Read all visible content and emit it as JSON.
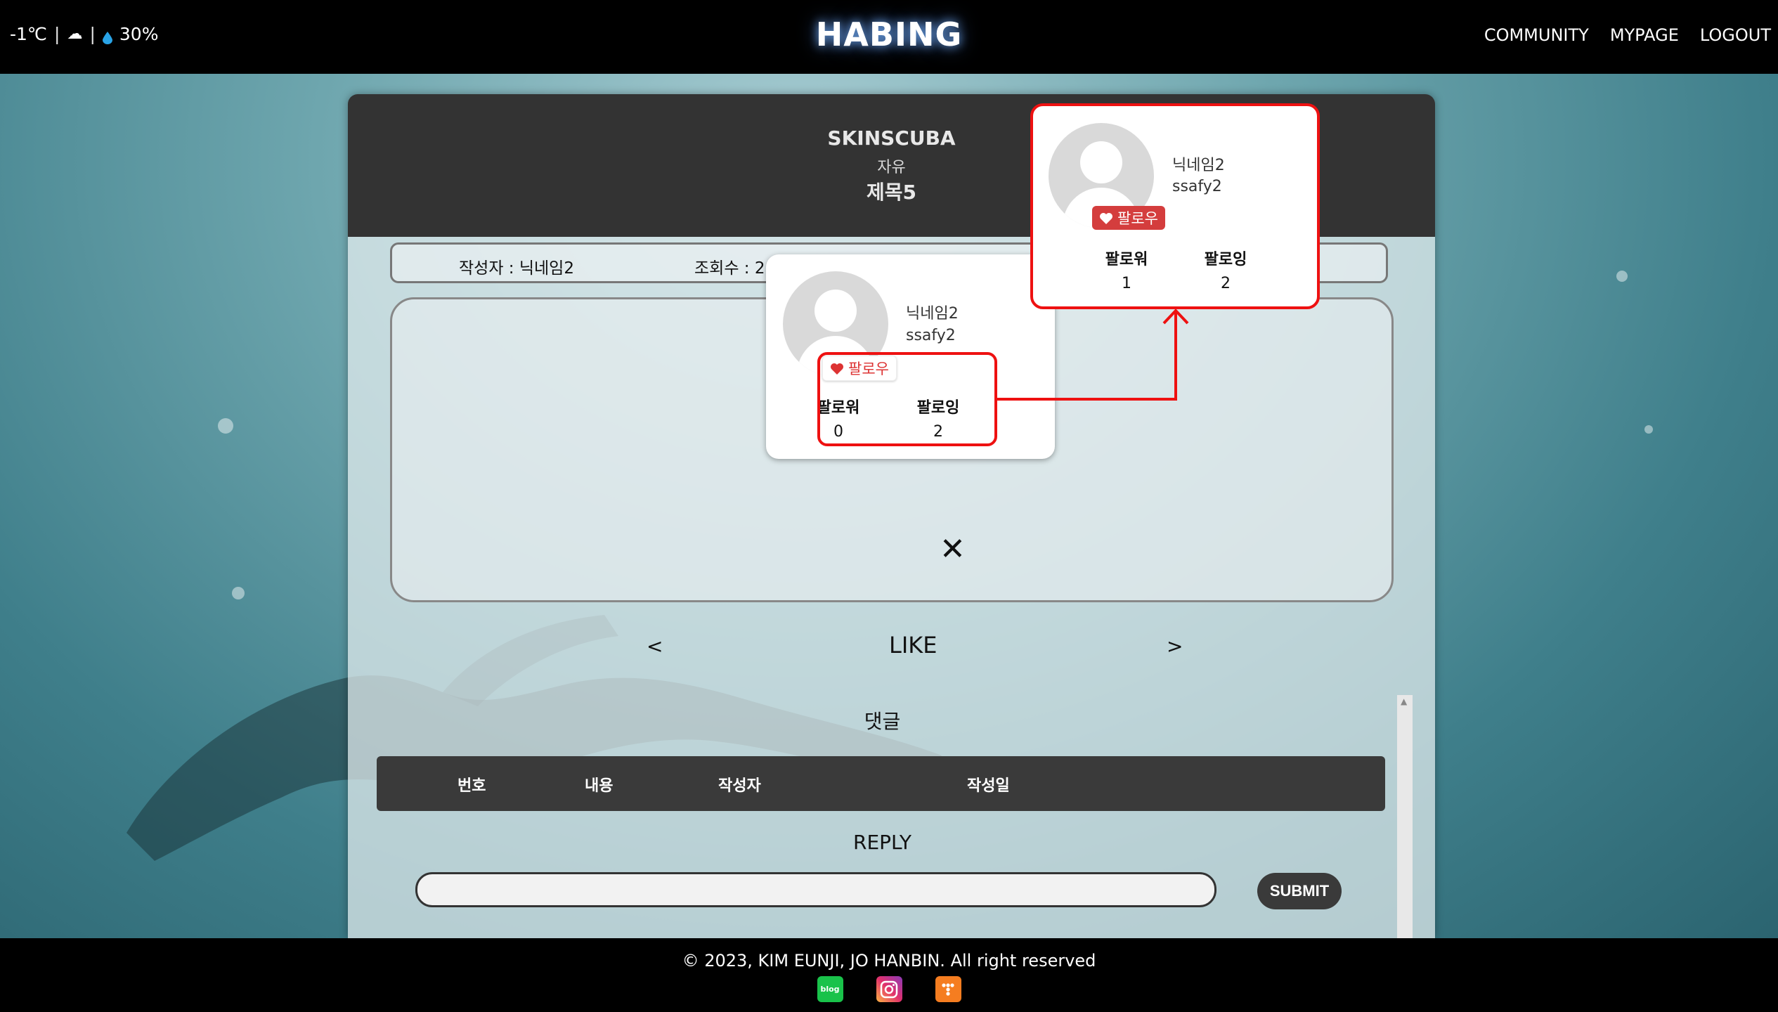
{
  "header": {
    "weather": {
      "temp": "-1℃",
      "sep1": "|",
      "cloud_icon": "☁",
      "sep2": "|",
      "drop_icon": "💧",
      "humidity": "30%"
    },
    "brand": "HABING",
    "nav": [
      {
        "label": "COMMUNITY"
      },
      {
        "label": "MYPAGE"
      },
      {
        "label": "LOGOUT"
      }
    ]
  },
  "post": {
    "category": "SKINSCUBA",
    "type": "자유",
    "title": "제목5",
    "author": "작성자 : 닉네임2",
    "views": "조회수 : 2",
    "close_symbol": "✕",
    "prev": "<",
    "like": "LIKE",
    "next": ">"
  },
  "comments": {
    "title": "댓글",
    "columns": [
      "번호",
      "내용",
      "작성자",
      "작성일"
    ],
    "scroll_arrow": "▲",
    "reply_title": "REPLY",
    "reply_value": "",
    "submit": "SUBMIT"
  },
  "popup_before": {
    "nickname": "닉네임2",
    "user_id": "ssafy2",
    "follow_label": "팔로우",
    "follower_label": "팔로워",
    "follower_count": "0",
    "following_label": "팔로잉",
    "following_count": "2"
  },
  "popup_after": {
    "nickname": "닉네임2",
    "user_id": "ssafy2",
    "follow_label": "팔로우",
    "follower_label": "팔로워",
    "follower_count": "1",
    "following_label": "팔로잉",
    "following_count": "2"
  },
  "annotation_color": "#e11111",
  "footer": {
    "copyright": "© 2023, KIM EUNJI, JO HANBIN. All right reserved",
    "icons": [
      {
        "name": "blog-icon",
        "label": "blog"
      },
      {
        "name": "instagram-icon",
        "label": ""
      },
      {
        "name": "tistory-icon",
        "label": ""
      }
    ]
  }
}
